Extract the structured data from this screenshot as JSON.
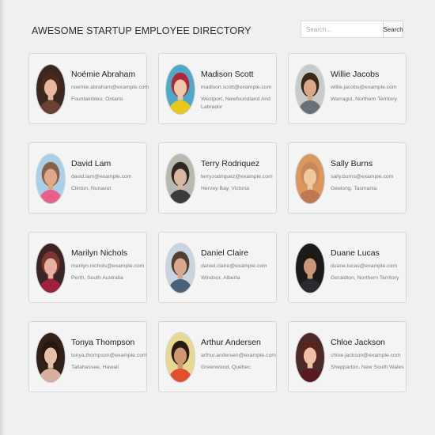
{
  "header": {
    "title": "AWESOME STARTUP EMPLOYEE DIRECTORY",
    "search_placeholder": "Search...",
    "search_button": "Search"
  },
  "employees": [
    {
      "name": "Noémie Abraham",
      "email": "noemie.abraham@example.com",
      "location": "Fountainbleu, Ontario",
      "avatar": {
        "bg": "#3a2820",
        "skin": "#e8b8a0",
        "hair": "#4a2a1c",
        "shirt": "#6a4030"
      }
    },
    {
      "name": "Madison Scott",
      "email": "madison.scott@example.com",
      "location": "Westport, Newfoundland And Labrador",
      "avatar": {
        "bg": "#4fa8c8",
        "skin": "#f0c8a8",
        "hair": "#b02838",
        "shirt": "#e8c818"
      }
    },
    {
      "name": "Willie Jacobs",
      "email": "willie.jacobs@example.com",
      "location": "Warragul, Northern Territory",
      "avatar": {
        "bg": "#c8ccc8",
        "skin": "#d8a888",
        "hair": "#3a2818",
        "shirt": "#6a7078"
      }
    },
    {
      "name": "David Lam",
      "email": "david.lam@example.com",
      "location": "Clinton, Nunavut",
      "avatar": {
        "bg": "#a8d0e8",
        "skin": "#e0a888",
        "hair": "#8a6048",
        "shirt": "#e86088"
      }
    },
    {
      "name": "Terry Rodriquez",
      "email": "terry.rodriquez@example.com",
      "location": "Hervey Bay, Victoria",
      "avatar": {
        "bg": "#b8b8b0",
        "skin": "#d8b8a0",
        "hair": "#302820",
        "shirt": "#3a3a3a"
      }
    },
    {
      "name": "Sally Burns",
      "email": "sally.burns@example.com",
      "location": "Geelong, Tasmania",
      "avatar": {
        "bg": "#d89860",
        "skin": "#f0c8a0",
        "hair": "#c88858",
        "shirt": "#c07850"
      }
    },
    {
      "name": "Marilyn Nichols",
      "email": "marilyn.nichols@example.com",
      "location": "Perth, South Australia",
      "avatar": {
        "bg": "#3a2428",
        "skin": "#e8b0a0",
        "hair": "#7a3830",
        "shirt": "#a02040"
      }
    },
    {
      "name": "Daniel Claire",
      "email": "daniel.claire@example.com",
      "location": "Windsor, Alberta",
      "avatar": {
        "bg": "#c8d4e0",
        "skin": "#d8a890",
        "hair": "#504030",
        "shirt": "#48607a"
      }
    },
    {
      "name": "Duane Lucas",
      "email": "duane.lucas@example.com",
      "location": "Geraldton, Northern Territory",
      "avatar": {
        "bg": "#1a1a1c",
        "skin": "#c89878",
        "hair": "#201812",
        "shirt": "#2a2a30"
      }
    },
    {
      "name": "Tonya Thompson",
      "email": "tonya.thompson@example.com",
      "location": "Tallahassee, Hawaii",
      "avatar": {
        "bg": "#302018",
        "skin": "#e8c0a8",
        "hair": "#281810",
        "shirt": "#d8b0a0"
      }
    },
    {
      "name": "Arthur Andersen",
      "email": "arthur.andersen@example.com",
      "location": "Greenwood, Québec",
      "avatar": {
        "bg": "#e8d890",
        "skin": "#d09870",
        "hair": "#281c14",
        "shirt": "#e05030"
      }
    },
    {
      "name": "Chloe Jackson",
      "email": "chloe.jackson@example.com",
      "location": "Shepparton, New South Wales",
      "avatar": {
        "bg": "#4a2a28",
        "skin": "#f0c0a8",
        "hair": "#5a2418",
        "shirt": "#5a1820"
      }
    }
  ]
}
